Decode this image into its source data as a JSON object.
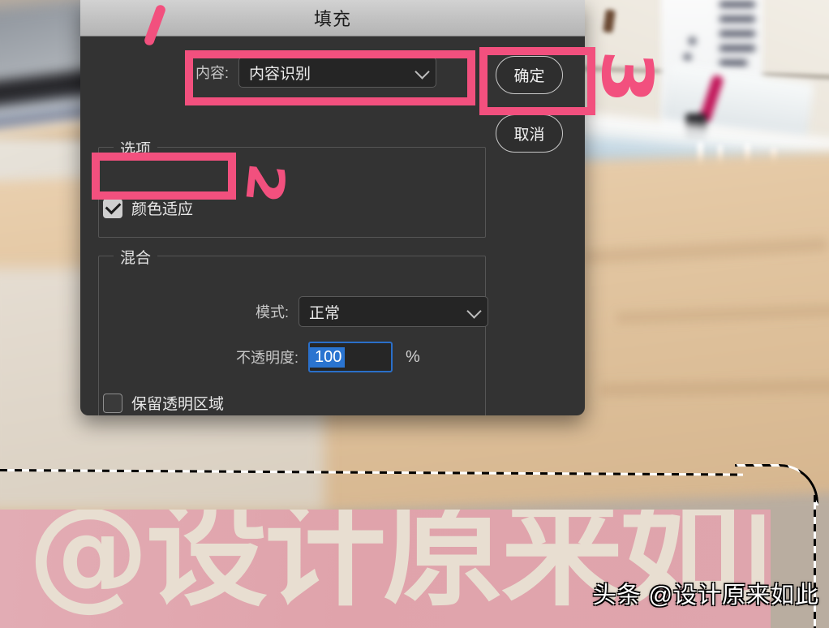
{
  "dialog": {
    "title": "填充",
    "content_row": {
      "label": "内容:",
      "value": "内容识别"
    },
    "buttons": {
      "ok": "确定",
      "cancel": "取消"
    },
    "options_group": {
      "legend": "选项",
      "color_adaptation": {
        "label": "颜色适应",
        "checked": "true"
      }
    },
    "blend_group": {
      "legend": "混合",
      "mode": {
        "label": "模式:",
        "value": "正常"
      },
      "opacity": {
        "label": "不透明度:",
        "value": "100",
        "unit": "%"
      },
      "preserve_transparency": {
        "label": "保留透明区域",
        "checked": "false"
      }
    }
  },
  "annotations": {
    "step1": "1",
    "step2": "2",
    "step3": "3",
    "accent_color": "#f2507e"
  },
  "canvas": {
    "banner_text": "@设计原来如此",
    "watermark": "头条 @设计原来如此"
  },
  "colors": {
    "dialog_bg": "#333333",
    "titlebar": "#c3c3c3",
    "field_bg": "#252525",
    "focus_blue": "#2a6fc9",
    "selection_blue": "#2a74d0",
    "banner_pink": "#e0a3ab"
  }
}
